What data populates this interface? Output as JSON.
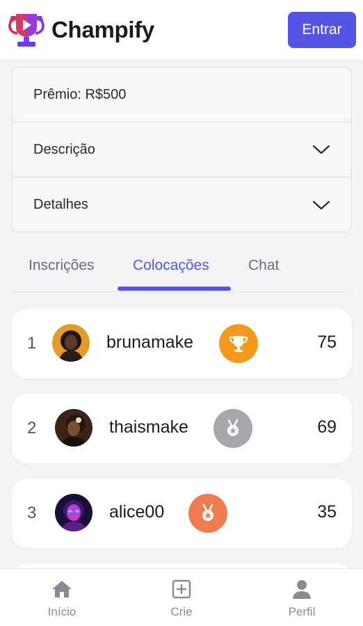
{
  "app": {
    "name": "Champify"
  },
  "header": {
    "login_label": "Entrar"
  },
  "info": {
    "prize": "Prêmio: R$500",
    "description_label": "Descrição",
    "details_label": "Detalhes"
  },
  "tabs": [
    {
      "label": "Inscrições",
      "active": false
    },
    {
      "label": "Colocações",
      "active": true
    },
    {
      "label": "Chat",
      "active": false
    }
  ],
  "leaderboard": [
    {
      "position": "1",
      "username": "brunamake",
      "score": "75",
      "medal": "trophy-icon",
      "medal_color": "#f5991c"
    },
    {
      "position": "2",
      "username": "thaismake",
      "score": "69",
      "medal": "silver-medal-icon",
      "medal_color": "#a5a7ad"
    },
    {
      "position": "3",
      "username": "alice00",
      "score": "35",
      "medal": "bronze-medal-icon",
      "medal_color": "#ef7c4e"
    }
  ],
  "nav": [
    {
      "label": "Início",
      "icon": "home-icon"
    },
    {
      "label": "Crie",
      "icon": "plus-square-icon"
    },
    {
      "label": "Perfil",
      "icon": "user-icon"
    }
  ],
  "colors": {
    "accent": "#5453e6",
    "background": "#f4f4f6"
  }
}
